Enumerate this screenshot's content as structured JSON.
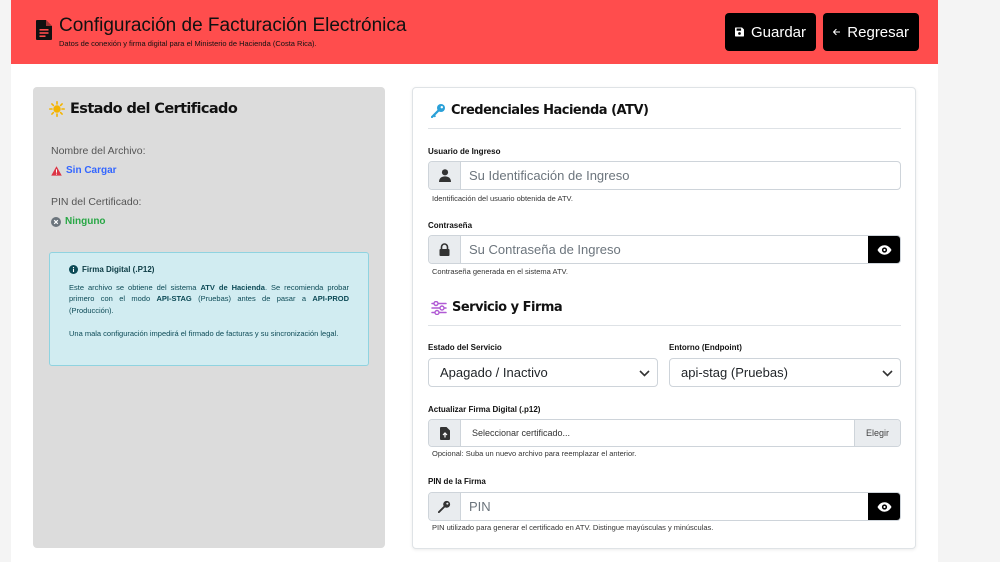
{
  "header": {
    "title": "Configuración de Facturación Electrónica",
    "subtitle": "Datos de conexión y firma digital para el Ministerio de Hacienda (Costa Rica).",
    "save_label": "Guardar",
    "back_label": "Regresar",
    "icon": "document-icon",
    "background": "#ff4d4d"
  },
  "certificate_status": {
    "title": "Estado del Certificado",
    "file_label": "Nombre del Archivo:",
    "file_value": "Sin Cargar",
    "pin_label": "PIN del Certificado:",
    "pin_value": "Ninguno",
    "info": {
      "title": "Firma Digital (.P12)",
      "p1_a": "Este archivo se obtiene del sistema ",
      "p1_b": "ATV de Hacienda",
      "p1_c": ". Se recomienda probar primero con el modo ",
      "p1_d": "API-STAG",
      "p1_e": " (Pruebas) antes de pasar a ",
      "p1_f": "API-PROD",
      "p1_g": " (Producción).",
      "p2": "Una mala configuración impedirá el firmado de facturas y su sincronización legal."
    }
  },
  "credentials": {
    "title": "Credenciales Hacienda (ATV)",
    "user_label": "Usuario de Ingreso",
    "user_placeholder": "Su Identificación de Ingreso",
    "user_help": "Identificación del usuario obtenida de ATV.",
    "password_label": "Contraseña",
    "password_placeholder": "Su Contraseña de Ingreso",
    "password_help": "Contraseña generada en el sistema ATV."
  },
  "service": {
    "title": "Servicio y Firma",
    "status_label": "Estado del Servicio",
    "status_value": "Apagado / Inactivo",
    "env_label": "Entorno (Endpoint)",
    "env_value": "api-stag (Pruebas)",
    "signature_label": "Actualizar Firma Digital (.p12)",
    "signature_placeholder": "Seleccionar certificado...",
    "choose_label": "Elegir",
    "signature_help": "Opcional: Suba un nuevo archivo para reemplazar el anterior.",
    "pin_label": "PIN de la Firma",
    "pin_placeholder": "PIN",
    "pin_help": "PIN utilizado para generar el certificado en ATV. Distingue mayúsculas y minúsculas."
  },
  "colors": {
    "accent_red": "#ff4d4d",
    "link_blue": "#3366ff",
    "success_green": "#28a745",
    "info_bg": "#d1ecf1"
  }
}
